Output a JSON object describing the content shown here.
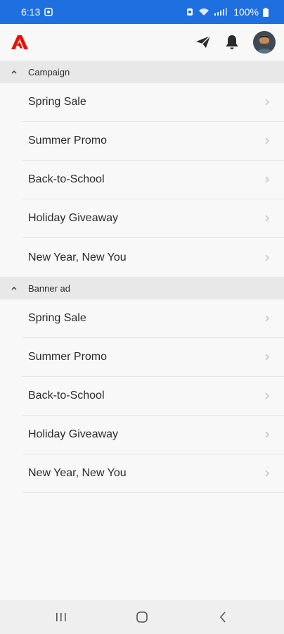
{
  "status_bar": {
    "time": "6:13",
    "battery_percent": "100%"
  },
  "header": {
    "logo_icon": "adobe-logo",
    "logo_color": "#eb1000",
    "send_icon": "paper-plane-icon",
    "notifications_icon": "bell-icon",
    "avatar_icon": "user-avatar"
  },
  "sections": [
    {
      "title": "Campaign",
      "expanded": true,
      "items": [
        "Spring Sale",
        "Summer Promo",
        "Back-to-School",
        "Holiday Giveaway",
        "New Year, New You"
      ]
    },
    {
      "title": "Banner ad",
      "expanded": true,
      "items": [
        "Spring Sale",
        "Summer Promo",
        "Back-to-School",
        "Holiday Giveaway",
        "New Year, New You"
      ]
    }
  ],
  "nav_bar": {
    "recents_icon": "recents-icon",
    "home_icon": "home-icon",
    "back_icon": "back-icon"
  },
  "colors": {
    "status_bar": "#1e6fe0",
    "section_header": "#e8e8e8",
    "background": "#f8f8f8"
  }
}
